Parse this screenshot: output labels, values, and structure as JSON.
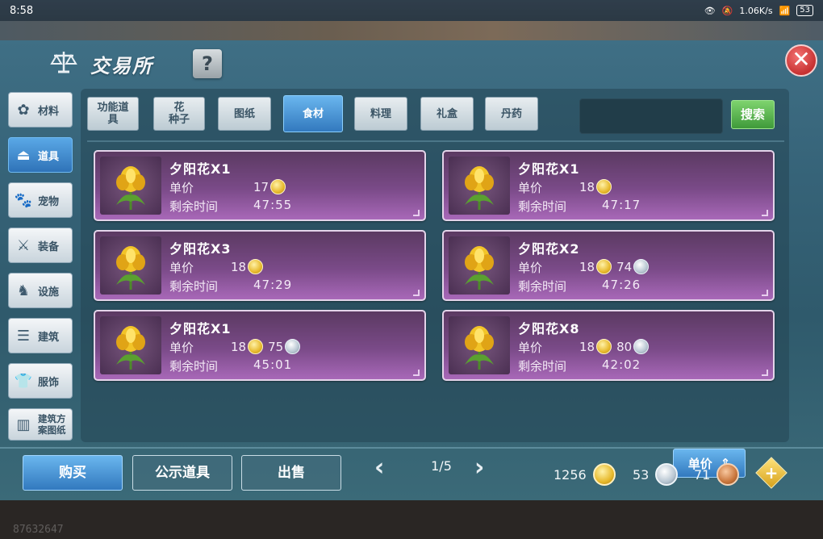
{
  "status_bar": {
    "time": "8:58",
    "network_speed": "1.06K/s",
    "battery": "53"
  },
  "header": {
    "title": "交易所",
    "help_label": "?",
    "close_label": "✕"
  },
  "sidebar": {
    "items": [
      {
        "label": "材料",
        "icon": "materials-icon",
        "active": false
      },
      {
        "label": "道具",
        "icon": "flask-icon",
        "active": true
      },
      {
        "label": "宠物",
        "icon": "paw-icon",
        "active": false
      },
      {
        "label": "装备",
        "icon": "equipment-icon",
        "active": false
      },
      {
        "label": "设施",
        "icon": "facility-icon",
        "active": false
      },
      {
        "label": "建筑",
        "icon": "building-icon",
        "active": false
      },
      {
        "label": "服饰",
        "icon": "clothing-icon",
        "active": false
      },
      {
        "label": "建筑方案图纸",
        "label_line1": "建筑方",
        "label_line2": "案图纸",
        "icon": "blueprint-icon",
        "active": false
      }
    ]
  },
  "tabs": [
    {
      "line1": "功能道",
      "line2": "具",
      "active": false
    },
    {
      "line1": "花",
      "line2": "种子",
      "active": false
    },
    {
      "line1": "图纸",
      "line2": "",
      "active": false
    },
    {
      "line1": "食材",
      "line2": "",
      "active": true
    },
    {
      "line1": "料理",
      "line2": "",
      "active": false
    },
    {
      "line1": "礼盒",
      "line2": "",
      "active": false
    },
    {
      "line1": "丹药",
      "line2": "",
      "active": false
    }
  ],
  "search": {
    "value": "",
    "button_label": "搜索"
  },
  "labels": {
    "price": "单价",
    "time_left": "剩余时间"
  },
  "listings": [
    {
      "name": "夕阳花X1",
      "gold": "17",
      "silver": "",
      "time": "47:55"
    },
    {
      "name": "夕阳花X1",
      "gold": "18",
      "silver": "",
      "time": "47:17"
    },
    {
      "name": "夕阳花X3",
      "gold": "18",
      "silver": "",
      "time": "47:29"
    },
    {
      "name": "夕阳花X2",
      "gold": "18",
      "silver": "74",
      "time": "47:26"
    },
    {
      "name": "夕阳花X1",
      "gold": "18",
      "silver": "75",
      "time": "45:01"
    },
    {
      "name": "夕阳花X8",
      "gold": "18",
      "silver": "80",
      "time": "42:02"
    }
  ],
  "pagination": {
    "text": "1/5"
  },
  "sort": {
    "label": "单价"
  },
  "bottom": {
    "buy": "购买",
    "show": "公示道具",
    "sell": "出售"
  },
  "currency": {
    "gold": "1256",
    "silver": "53",
    "bronze": "71"
  },
  "uid": "87632647",
  "colors": {
    "panel": "#366378",
    "card": "#7a4a88",
    "active_blue": "#3279be",
    "search_green": "#3f9a3a",
    "close_red": "#c63131"
  }
}
